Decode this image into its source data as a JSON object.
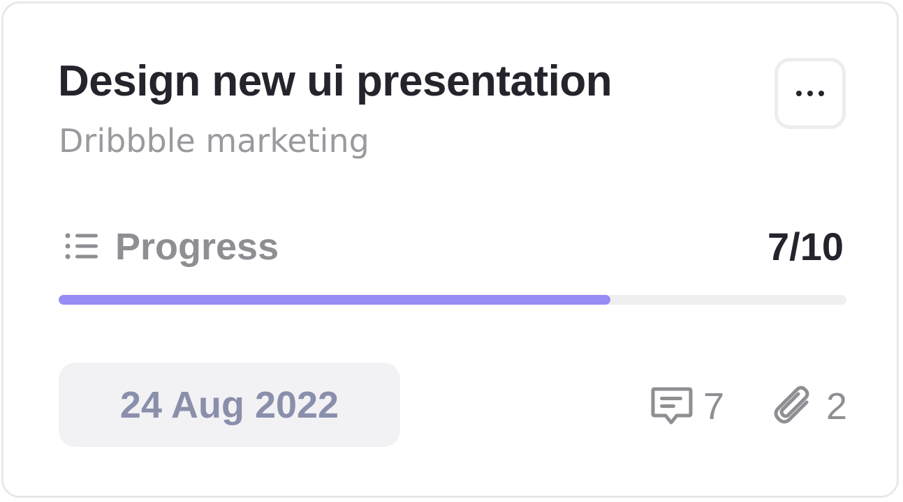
{
  "task": {
    "title": "Design new ui presentation",
    "project": "Dribbble marketing"
  },
  "menu": {
    "label": "...",
    "icon": "more-horizontal-icon"
  },
  "progress": {
    "label": "Progress",
    "icon": "list-icon",
    "completed": 7,
    "total": 10,
    "count_text": "7/10",
    "fraction": 0.7
  },
  "date": "24 Aug 2022",
  "stats": {
    "comments": {
      "icon": "comment-icon",
      "count": "7"
    },
    "attachments": {
      "icon": "paperclip-icon",
      "count": "2"
    }
  },
  "colors": {
    "accent": "#978bf5",
    "title": "#24242c",
    "muted": "#8e8e93",
    "date_text": "#8a8fab"
  }
}
